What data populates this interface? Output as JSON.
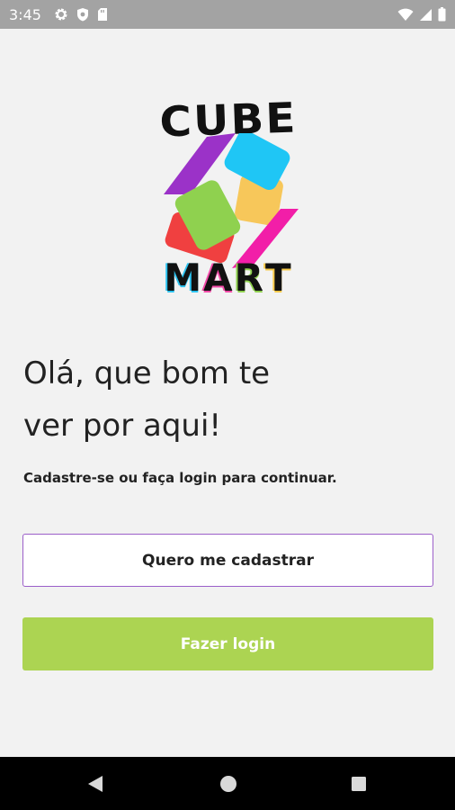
{
  "status_bar": {
    "time": "3:45",
    "left_icons": [
      "gear-icon",
      "shield-icon",
      "sd-card-icon"
    ],
    "right_icons": [
      "wifi-icon",
      "cellular-signal-icon",
      "battery-icon"
    ]
  },
  "logo": {
    "top_word": "CUBE",
    "bottom_letters": [
      "M",
      "A",
      "R",
      "T"
    ],
    "colors": {
      "purple": "#9b32c8",
      "blue": "#1fc6f5",
      "yellow": "#f7c75a",
      "green": "#8fd14f",
      "red": "#f04040",
      "pink": "#f21ea8"
    }
  },
  "greeting": {
    "line1": "Olá, que bom te",
    "line2": "ver por aqui!"
  },
  "subtitle": "Cadastre-se ou faça login para continuar.",
  "buttons": {
    "register": "Quero me cadastrar",
    "login": "Fazer login"
  },
  "theme": {
    "background": "#f2f2f2",
    "register_border": "#9b5fc9",
    "login_background": "#acd452",
    "status_bar": "#a3a3a3"
  },
  "nav_bar": {
    "icons": [
      "back-icon",
      "home-icon",
      "recents-icon"
    ]
  }
}
